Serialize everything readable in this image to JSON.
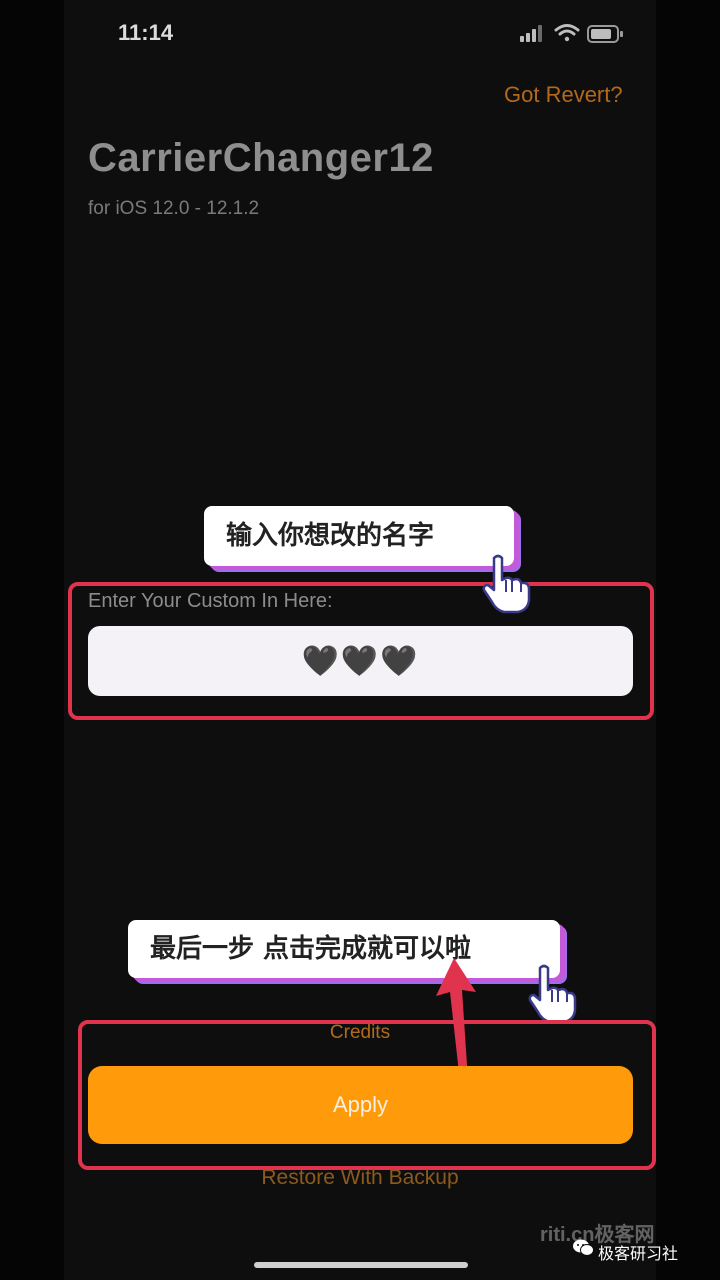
{
  "status_bar": {
    "time": "11:14"
  },
  "header": {
    "revert_link": "Got Revert?",
    "title": "CarrierChanger12",
    "subtitle": "for iOS 12.0 - 12.1.2"
  },
  "callouts": {
    "enter_name": "输入你想改的名字",
    "final_step": "最后一步 点击完成就可以啦"
  },
  "form": {
    "label": "Enter Your Custom In Here:",
    "value": "🖤🖤🖤"
  },
  "footer": {
    "credits": "Credits",
    "apply": "Apply",
    "restore": "Restore With Backup"
  },
  "watermark": {
    "url": "riti.cn极客网",
    "brand": "极客研习社"
  },
  "colors": {
    "accent_orange": "#ff9b0a",
    "link_orange": "#b2691c",
    "highlight_red": "#e0344e"
  },
  "icons": [
    "signal-icon",
    "wifi-icon",
    "battery-icon",
    "pointer-hand-icon",
    "up-arrow-icon",
    "wechat-icon"
  ]
}
